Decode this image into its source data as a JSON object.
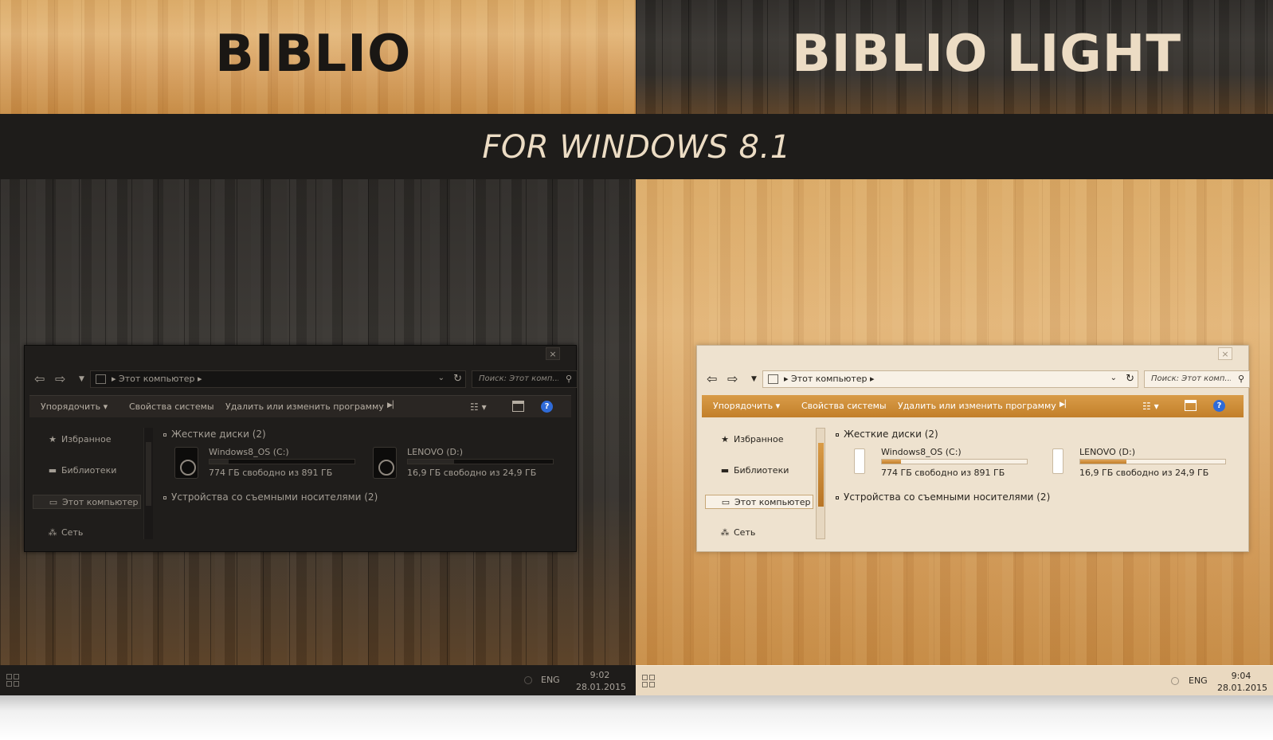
{
  "banner": {
    "left_title": "BIBLIO",
    "right_title": "BIBLIO LIGHT",
    "subtitle": "FOR WINDOWS 8.1"
  },
  "colors": {
    "dark_window_bg": "#1f1d1b",
    "light_window_bg": "#eee2cf",
    "light_toolbar_accent": "#c27f2a",
    "title_light_text": "#ecdcc4"
  },
  "explorer": {
    "breadcrumb": "Этот компьютер",
    "search_placeholder": "Поиск: Этот комп...",
    "close_label": "×",
    "toolbar": {
      "organize": "Упорядочить ▾",
      "system_properties": "Свойства системы",
      "uninstall": "Удалить или изменить программу",
      "help": "?"
    },
    "nav": {
      "favorites": "Избранное",
      "libraries": "Библиотеки",
      "this_pc": "Этот компьютер",
      "network": "Сеть"
    },
    "groups": {
      "hard_drives": "Жесткие диски (2)",
      "removable": "Устройства со съемными носителями (2)"
    },
    "drives": [
      {
        "name": "Windows8_OS (C:)",
        "free_text": "774 ГБ свободно из 891 ГБ",
        "used_fraction": 0.13
      },
      {
        "name": "LENOVO (D:)",
        "free_text": "16,9 ГБ свободно из 24,9 ГБ",
        "used_fraction": 0.32
      }
    ]
  },
  "taskbar_left": {
    "lang": "ENG",
    "time": "9:02",
    "date": "28.01.2015"
  },
  "taskbar_right": {
    "lang": "ENG",
    "time": "9:04",
    "date": "28.01.2015"
  }
}
